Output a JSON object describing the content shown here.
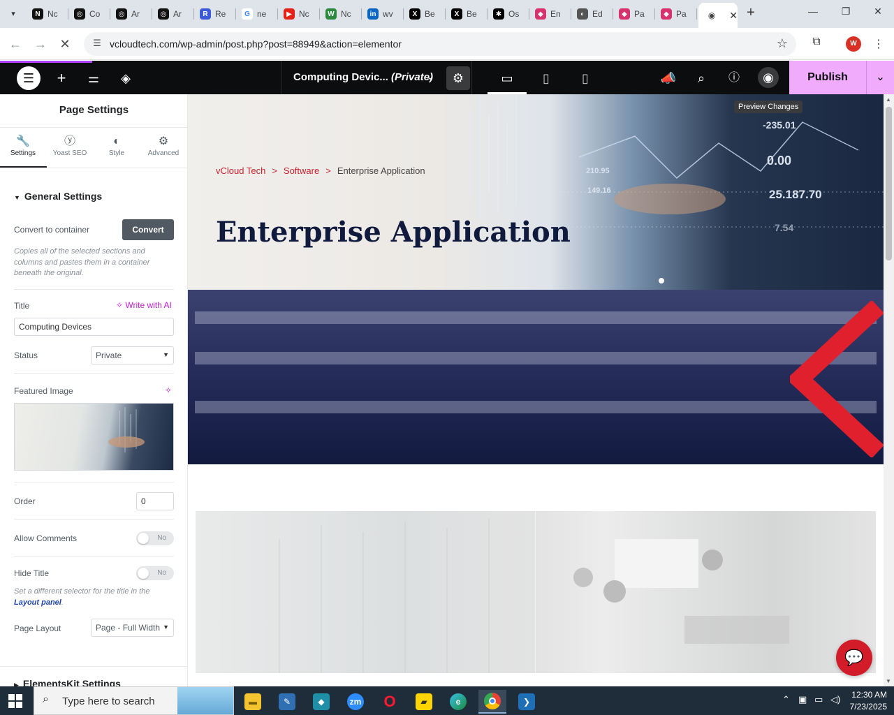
{
  "browser": {
    "tabs": [
      {
        "label": "Nc",
        "fav": "N",
        "color": "#111111"
      },
      {
        "label": "Co",
        "fav": "◎",
        "color": "#111111"
      },
      {
        "label": "Ar",
        "fav": "◎",
        "color": "#111111"
      },
      {
        "label": "Ar",
        "fav": "◎",
        "color": "#111111"
      },
      {
        "label": "Re",
        "fav": "R",
        "color": "#3b5bdb"
      },
      {
        "label": "ne",
        "fav": "G",
        "color": "#ffffff"
      },
      {
        "label": "Nc",
        "fav": "▶",
        "color": "#e62117"
      },
      {
        "label": "Nc",
        "fav": "W",
        "color": "#2b8a3e"
      },
      {
        "label": "wv",
        "fav": "in",
        "color": "#0a66c2"
      },
      {
        "label": "Be",
        "fav": "X",
        "color": "#000000"
      },
      {
        "label": "Be",
        "fav": "X",
        "color": "#000000"
      },
      {
        "label": "Os",
        "fav": "✱",
        "color": "#000000"
      },
      {
        "label": "En",
        "fav": "◆",
        "color": "#d6336c"
      },
      {
        "label": "Ed",
        "fav": "◐",
        "color": "#555555"
      },
      {
        "label": "Pa",
        "fav": "◆",
        "color": "#d6336c"
      },
      {
        "label": "Pa",
        "fav": "◆",
        "color": "#d6336c"
      }
    ],
    "active_tab_fav": "◉",
    "close": "✕",
    "new_tab": "+",
    "url": "vcloudtech.com/wp-admin/post.php?post=88949&action=elementor",
    "profile_initial": "W"
  },
  "elementor": {
    "doc_title": "Computing Devic...",
    "doc_status": "(Private)",
    "publish": "Publish",
    "preview_tooltip": "Preview Changes"
  },
  "panel": {
    "title": "Page Settings",
    "tabs": [
      {
        "label": "Settings",
        "icon": "wrench-icon"
      },
      {
        "label": "Yoast SEO",
        "icon": "yoast-icon"
      },
      {
        "label": "Style",
        "icon": "half-circle-icon"
      },
      {
        "label": "Advanced",
        "icon": "gear-icon"
      }
    ],
    "general_settings": "General Settings",
    "convert_label": "Convert to container",
    "convert_button": "Convert",
    "convert_note": "Copies all of the selected sections and columns and pastes them in a container beneath the original.",
    "title_label": "Title",
    "write_ai": "Write with AI",
    "title_value": "Computing Devices",
    "status_label": "Status",
    "status_value": "Private",
    "featured_label": "Featured Image",
    "order_label": "Order",
    "order_value": "0",
    "allow_comments_label": "Allow Comments",
    "allow_comments_value": "No",
    "hide_title_label": "Hide Title",
    "hide_title_value": "No",
    "hide_note_prefix": "Set a different selector for the title in the",
    "hide_note_link": "Layout panel",
    "hide_note_suffix": ".",
    "page_layout_label": "Page Layout",
    "page_layout_value": "Page - Full Width",
    "elementskit": "ElementsKit Settings"
  },
  "preview": {
    "crumb_home": "vCloud Tech",
    "crumb_sep": ">",
    "crumb_mid": "Software",
    "crumb_current": "Enterprise Application",
    "hero_title": "Enterprise Application",
    "hero_numbers": [
      "-235.01",
      "0.00",
      "25.187.70",
      "210.95",
      "149.16",
      "7.54"
    ]
  },
  "taskbar": {
    "search_placeholder": "Type here to search",
    "time": "12:30 AM",
    "date": "7/23/2025"
  }
}
